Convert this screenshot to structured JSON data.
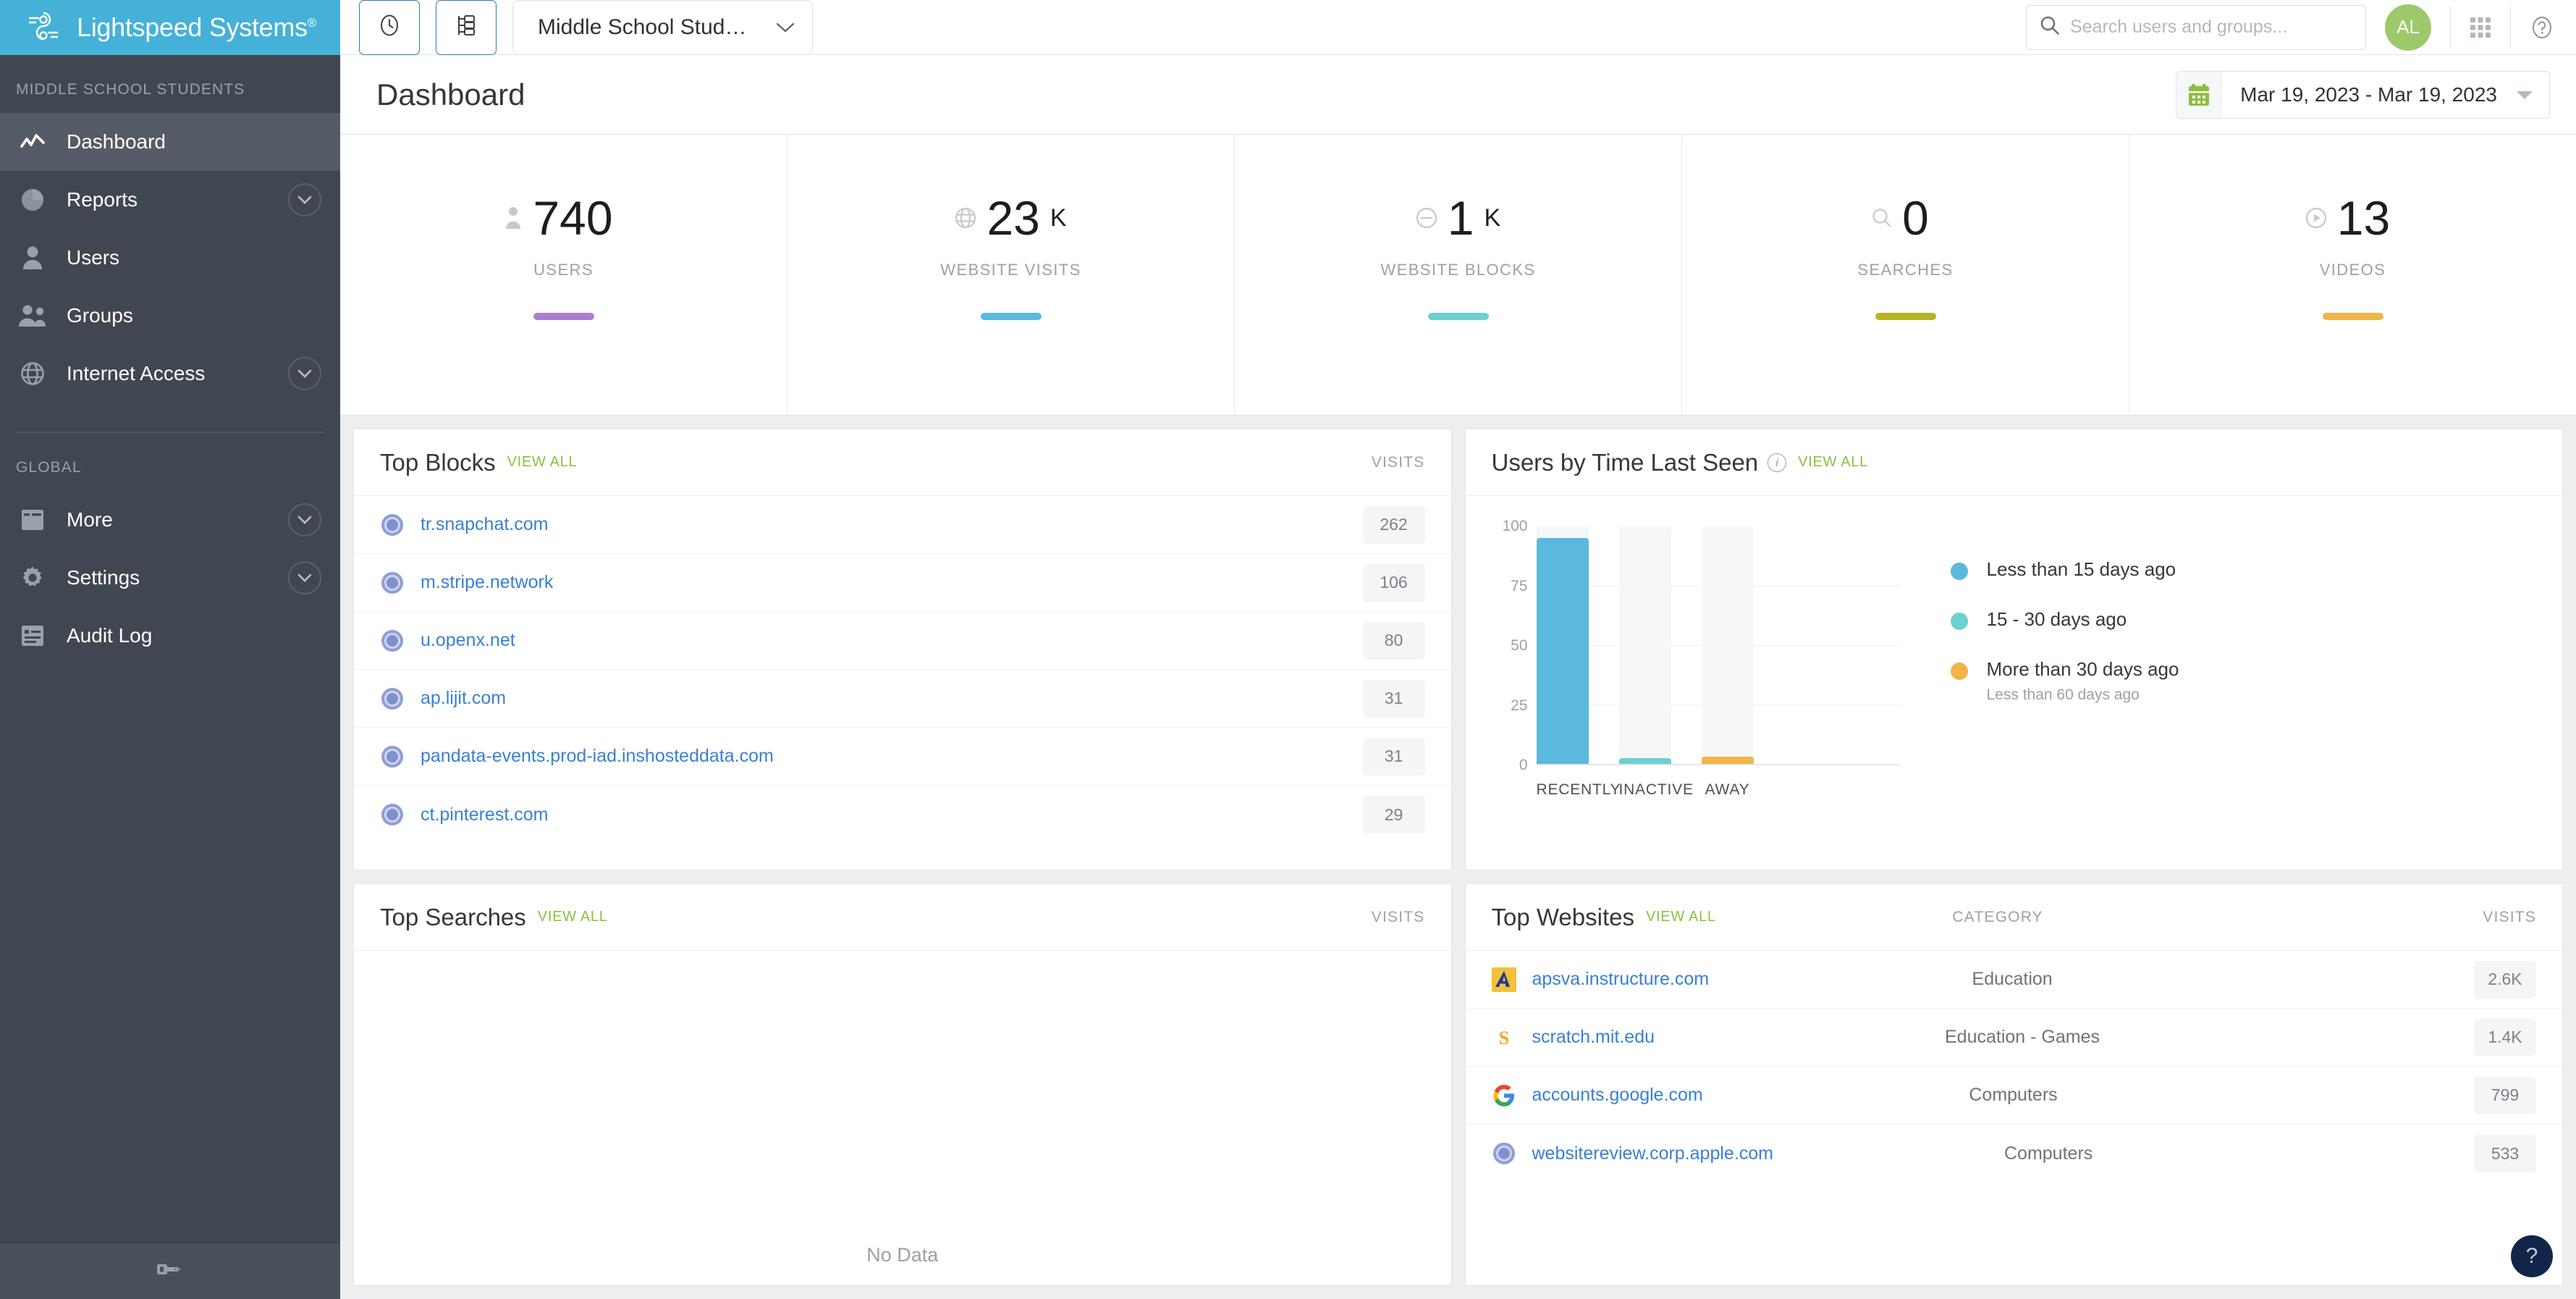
{
  "brand": {
    "name": "Lightspeed Systems",
    "reg": "®",
    "logo_icon": "lightspeed-logo-icon"
  },
  "topbar": {
    "history_button_icon": "clock-icon",
    "hierarchy_button_icon": "org-tree-icon",
    "scope_selector": {
      "value": "Middle School Stud…",
      "chevron_icon": "chevron-down-icon"
    },
    "search": {
      "placeholder": "Search users and groups...",
      "value": "",
      "icon": "search-icon"
    },
    "avatar_initials": "AL",
    "apps_icon": "apps-grid-icon",
    "help_icon": "help-circle-icon"
  },
  "page": {
    "title": "Dashboard",
    "date_range": {
      "value": "Mar 19, 2023 - Mar 19, 2023",
      "calendar_icon": "calendar-icon",
      "caret_icon": "caret-down-icon"
    }
  },
  "sidebar": {
    "section_label": "MIDDLE SCHOOL STUDENTS",
    "global_label": "GLOBAL",
    "collapse_icon": "collapse-panel-icon",
    "items": [
      {
        "label": "Dashboard",
        "icon": "trendline-icon",
        "active": true,
        "expandable": false
      },
      {
        "label": "Reports",
        "icon": "pie-chart-icon",
        "active": false,
        "expandable": true
      },
      {
        "label": "Users",
        "icon": "user-icon",
        "active": false,
        "expandable": false
      },
      {
        "label": "Groups",
        "icon": "users-group-icon",
        "active": false,
        "expandable": false
      },
      {
        "label": "Internet Access",
        "icon": "globe-icon",
        "active": false,
        "expandable": true
      }
    ],
    "global_items": [
      {
        "label": "More",
        "icon": "window-icon",
        "active": false,
        "expandable": true
      },
      {
        "label": "Settings",
        "icon": "gear-icon",
        "active": false,
        "expandable": true
      },
      {
        "label": "Audit Log",
        "icon": "list-document-icon",
        "active": false,
        "expandable": false
      }
    ]
  },
  "kpis": [
    {
      "value": "740",
      "suffix": "",
      "label": "USERS",
      "color": "#a97fd1",
      "icon": "person-icon"
    },
    {
      "value": "23",
      "suffix": "K",
      "label": "WEBSITE VISITS",
      "color": "#5ab9dd",
      "icon": "globe-icon"
    },
    {
      "value": "1",
      "suffix": "K",
      "label": "WEBSITE BLOCKS",
      "color": "#6ed0cf",
      "icon": "block-icon"
    },
    {
      "value": "0",
      "suffix": "",
      "label": "SEARCHES",
      "color": "#b5b523",
      "icon": "magnifier-icon"
    },
    {
      "value": "13",
      "suffix": "",
      "label": "VIDEOS",
      "color": "#f0b44b",
      "icon": "play-circle-icon"
    }
  ],
  "top_blocks": {
    "title": "Top Blocks",
    "view_all": "VIEW ALL",
    "visits_header": "VISITS",
    "rows": [
      {
        "site": "tr.snapchat.com",
        "visits": "262",
        "favicon": "globe-favicon"
      },
      {
        "site": "m.stripe.network",
        "visits": "106",
        "favicon": "globe-favicon"
      },
      {
        "site": "u.openx.net",
        "visits": "80",
        "favicon": "globe-favicon"
      },
      {
        "site": "ap.lijit.com",
        "visits": "31",
        "favicon": "globe-favicon"
      },
      {
        "site": "pandata-events.prod-iad.inshosteddata.com",
        "visits": "31",
        "favicon": "globe-favicon"
      },
      {
        "site": "ct.pinterest.com",
        "visits": "29",
        "favicon": "globe-favicon"
      }
    ]
  },
  "top_searches": {
    "title": "Top Searches",
    "view_all": "VIEW ALL",
    "visits_header": "VISITS",
    "empty_text": "No Data"
  },
  "top_websites": {
    "title": "Top Websites",
    "view_all": "VIEW ALL",
    "category_header": "CATEGORY",
    "visits_header": "VISITS",
    "rows": [
      {
        "site": "apsva.instructure.com",
        "category": "Education",
        "visits": "2.6K",
        "favicon": "canvas-favicon"
      },
      {
        "site": "scratch.mit.edu",
        "category": "Education - Games",
        "visits": "1.4K",
        "favicon": "scratch-favicon"
      },
      {
        "site": "accounts.google.com",
        "category": "Computers",
        "visits": "799",
        "favicon": "google-favicon"
      },
      {
        "site": "websitereview.corp.apple.com",
        "category": "Computers",
        "visits": "533",
        "favicon": "globe-favicon"
      }
    ]
  },
  "users_by_time": {
    "title": "Users by Time Last Seen",
    "view_all": "VIEW ALL",
    "info_icon": "info-icon"
  },
  "chart_data": {
    "type": "bar",
    "title": "Users by Time Last Seen",
    "categories": [
      "RECENTLY",
      "INACTIVE",
      "AWAY"
    ],
    "values": [
      95,
      2,
      3
    ],
    "colors": [
      "#5ab9dd",
      "#6ed0cf",
      "#f0b44b"
    ],
    "ylabel": "",
    "xlabel": "",
    "ylim": [
      0,
      100
    ],
    "yticks": [
      0,
      25,
      50,
      75,
      100
    ],
    "ytick_labels": [
      "0",
      "25",
      "50",
      "75",
      "100"
    ],
    "grid": true,
    "legend_position": "right",
    "legend": [
      {
        "label": "Less than 15 days ago",
        "sub": "",
        "color": "#5ab9dd"
      },
      {
        "label": "15 - 30 days ago",
        "sub": "",
        "color": "#6ed0cf"
      },
      {
        "label": "More than 30 days ago",
        "sub": "Less than 60 days ago",
        "color": "#f0b44b"
      }
    ]
  },
  "help_fab": {
    "label": "?"
  }
}
